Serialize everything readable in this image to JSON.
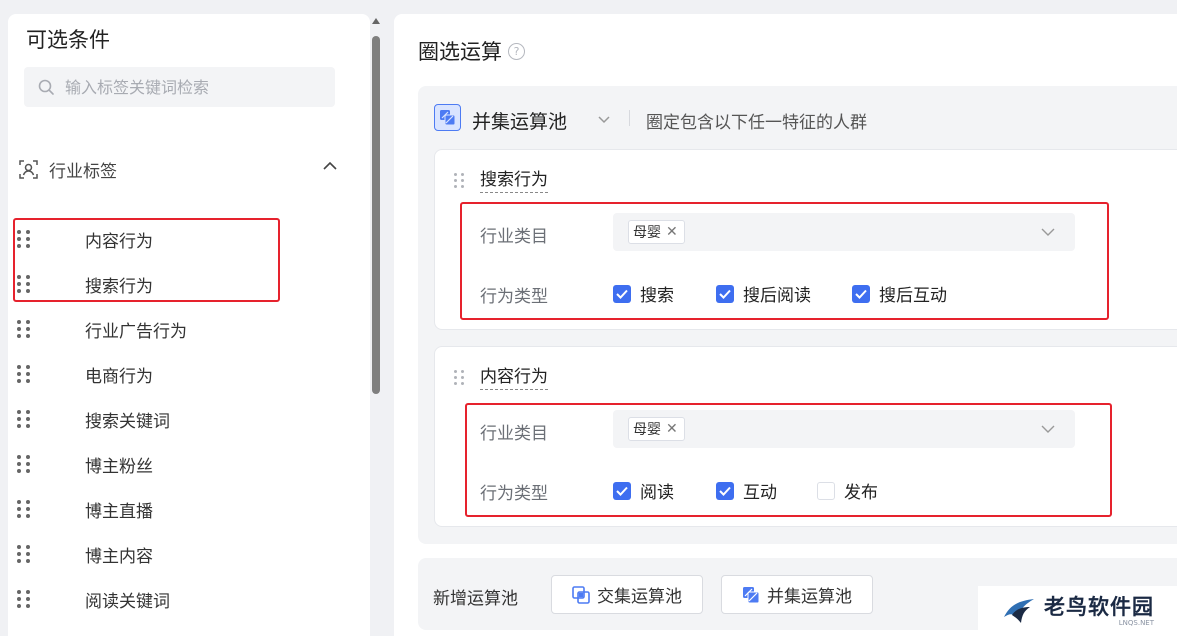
{
  "sidebar": {
    "title": "可选条件",
    "search_placeholder": "输入标签关键词检索",
    "group": {
      "label": "行业标签",
      "expanded": true
    },
    "items": [
      {
        "label": "内容行为"
      },
      {
        "label": "搜索行为"
      },
      {
        "label": "行业广告行为"
      },
      {
        "label": "电商行为"
      },
      {
        "label": "搜索关键词"
      },
      {
        "label": "博主粉丝"
      },
      {
        "label": "博主直播"
      },
      {
        "label": "博主内容"
      },
      {
        "label": "阅读关键词"
      }
    ]
  },
  "main": {
    "title": "圈选运算",
    "help_symbol": "?",
    "pool": {
      "name": "并集运算池",
      "description": "圈定包含以下任一特征的人群"
    },
    "cards": [
      {
        "title": "搜索行为",
        "category_label": "行业类目",
        "category_tags": [
          "母婴"
        ],
        "behavior_label": "行为类型",
        "options": [
          {
            "label": "搜索",
            "checked": true
          },
          {
            "label": "搜后阅读",
            "checked": true
          },
          {
            "label": "搜后互动",
            "checked": true
          }
        ]
      },
      {
        "title": "内容行为",
        "category_label": "行业类目",
        "category_tags": [
          "母婴"
        ],
        "behavior_label": "行为类型",
        "options": [
          {
            "label": "阅读",
            "checked": true
          },
          {
            "label": "互动",
            "checked": true
          },
          {
            "label": "发布",
            "checked": false
          }
        ]
      }
    ],
    "add_pool": {
      "label": "新增运算池",
      "intersection_button": "交集运算池",
      "union_button": "并集运算池"
    }
  },
  "watermark": {
    "text": "老鸟软件园",
    "sub": "LNQS.NET"
  },
  "colors": {
    "accent": "#3e6ef0",
    "highlight_box": "#e6222d",
    "panel_bg": "#f3f4f6"
  }
}
